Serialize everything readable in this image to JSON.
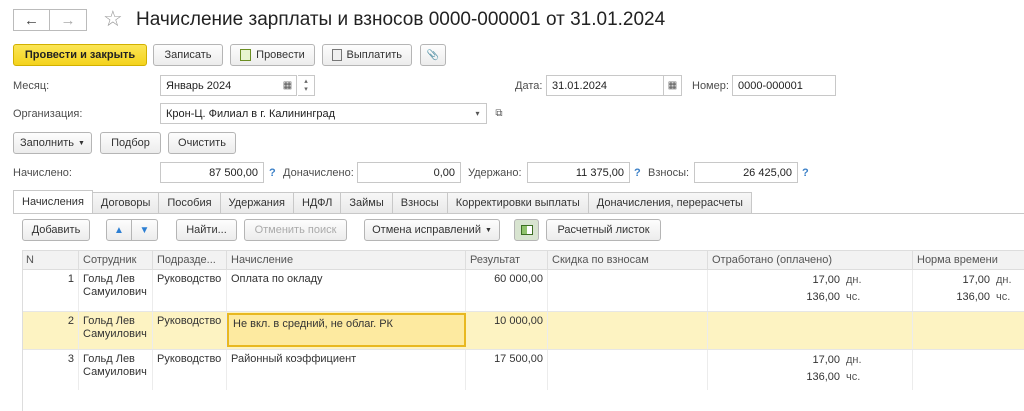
{
  "window": {
    "title": "Начисление зарплаты и взносов 0000-000001 от 31.01.2024",
    "back_icon": "←",
    "forward_icon": "→",
    "star_icon": "☆"
  },
  "toolbar": {
    "post_close": "Провести и закрыть",
    "save": "Записать",
    "post": "Провести",
    "pay": "Выплатить",
    "attach_icon": "📎"
  },
  "header": {
    "month_label": "Месяц:",
    "month_value": "Январь 2024",
    "date_label": "Дата:",
    "date_value": "31.01.2024",
    "number_label": "Номер:",
    "number_value": "0000-000001",
    "org_label": "Организация:",
    "org_value": "Крон-Ц. Филиал в г. Калининград"
  },
  "actions": {
    "fill": "Заполнить",
    "select": "Подбор",
    "clear": "Очистить"
  },
  "totals": {
    "accrued_label": "Начислено:",
    "accrued_value": "87 500,00",
    "additional_label": "Доначислено:",
    "additional_value": "0,00",
    "withheld_label": "Удержано:",
    "withheld_value": "11 375,00",
    "contrib_label": "Взносы:",
    "contrib_value": "26 425,00",
    "help": "?"
  },
  "tabs": [
    {
      "label": "Начисления",
      "active": true
    },
    {
      "label": "Договоры"
    },
    {
      "label": "Пособия"
    },
    {
      "label": "Удержания"
    },
    {
      "label": "НДФЛ"
    },
    {
      "label": "Займы"
    },
    {
      "label": "Взносы"
    },
    {
      "label": "Корректировки выплаты"
    },
    {
      "label": "Доначисления, перерасчеты"
    }
  ],
  "grid_toolbar": {
    "add": "Добавить",
    "find": "Найти...",
    "cancel_search": "Отменить поиск",
    "cancel_corrections": "Отмена исправлений",
    "payslip": "Расчетный листок"
  },
  "columns": [
    "N",
    "Сотрудник",
    "Подразде...",
    "Начисление",
    "Результат",
    "Скидка по взносам",
    "Отработано (оплачено)",
    "Норма времени"
  ],
  "rows": [
    {
      "n": "1",
      "emp1": "Гольд Лев",
      "emp2": "Самуилович",
      "dept": "Руководство",
      "accr": "Оплата по окладу",
      "result": "60 000,00",
      "worked_d": "17,00",
      "worked_h": "136,00",
      "norm_d": "17,00",
      "norm_h": "136,00",
      "u_d": "дн.",
      "u_h": "чс."
    },
    {
      "n": "2",
      "emp1": "Гольд Лев",
      "emp2": "Самуилович",
      "dept": "Руководство",
      "accr": "Не вкл. в средний, не облаг. РК",
      "result": "10 000,00",
      "worked_d": "",
      "worked_h": "",
      "norm_d": "",
      "norm_h": "",
      "u_d": "",
      "u_h": ""
    },
    {
      "n": "3",
      "emp1": "Гольд Лев",
      "emp2": "Самуилович",
      "dept": "Руководство",
      "accr": "Районный коэффициент",
      "result": "17 500,00",
      "worked_d": "17,00",
      "worked_h": "136,00",
      "norm_d": "",
      "norm_h": "",
      "u_d": "дн.",
      "u_h": "чс."
    }
  ]
}
